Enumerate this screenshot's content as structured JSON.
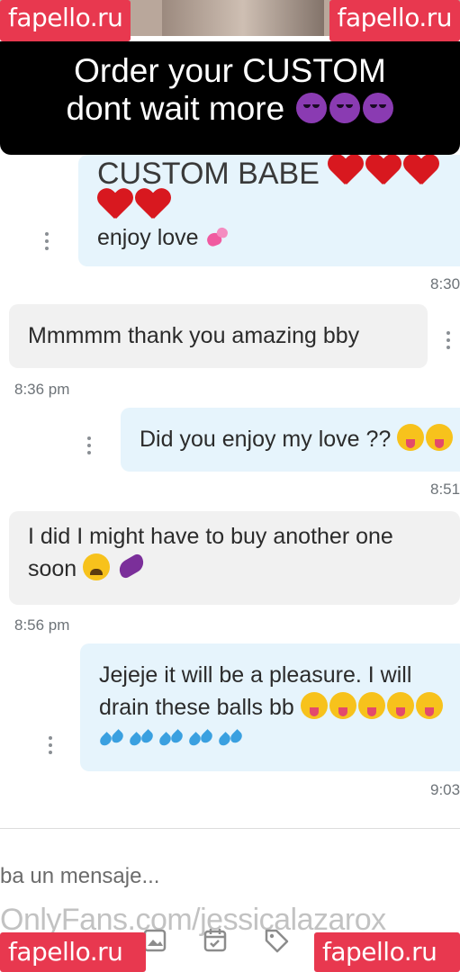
{
  "watermarks": {
    "top_left": "fapello.ru",
    "top_right": "fapello.ru",
    "bottom_left": "fapello.ru",
    "bottom_right": "fapello.ru"
  },
  "banner": {
    "line1": "Order your CUSTOM",
    "line2": "dont wait more"
  },
  "messages": [
    {
      "line1": "CUSTOM BABE",
      "line2": "enjoy love",
      "time": "8:30"
    },
    {
      "text": "Mmmmm thank you amazing bby",
      "time": "8:36 pm"
    },
    {
      "text": "Did you enjoy my love ??",
      "time": "8:51"
    },
    {
      "line1": "I did I might have to buy another one",
      "line2": "soon",
      "time": "8:56 pm"
    },
    {
      "line1": "Jejeje it will be a pleasure. I will",
      "line2": "drain these balls bb",
      "time": "9:03"
    }
  ],
  "composer": {
    "placeholder": "ba un mensaje..."
  },
  "overlay": {
    "onlyfans_text": "OnlyFans.com/jessicalazarox"
  },
  "icons": [
    "more-options-icon",
    "image-icon",
    "schedule-icon",
    "price-tag-icon"
  ],
  "colors": {
    "outgoing_bubble": "#e6f4fc",
    "incoming_bubble": "#f1f1f1",
    "watermark": "#e8384f",
    "banner": "#000000"
  }
}
